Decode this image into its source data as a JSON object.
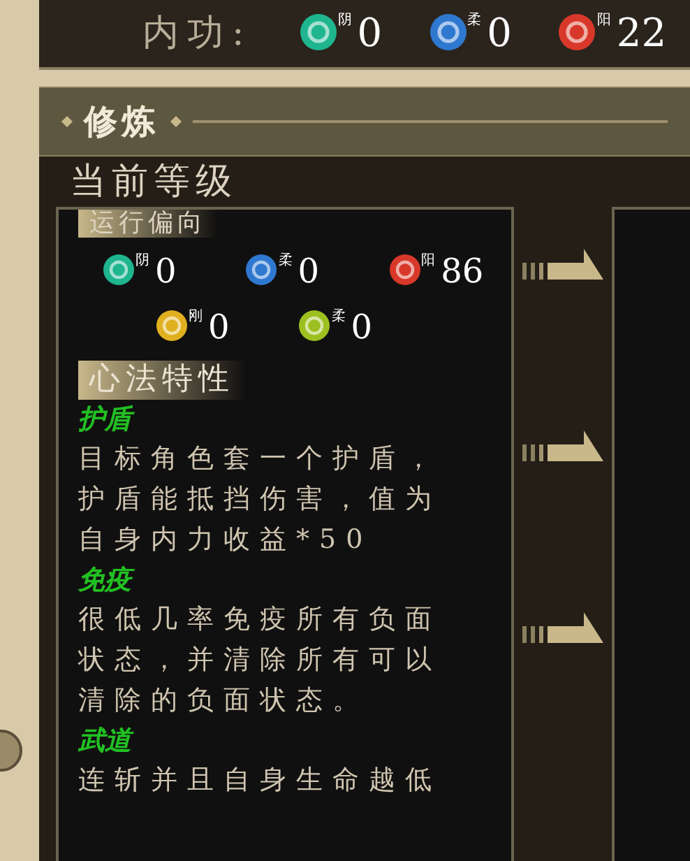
{
  "internal_power": {
    "label": "内功:",
    "orbs": [
      {
        "tag": "阴",
        "value": "0",
        "color": "#1fb58f"
      },
      {
        "tag": "柔",
        "value": "0",
        "color": "#2f78d0"
      },
      {
        "tag": "阳",
        "value": "22",
        "color": "#d8382a"
      }
    ]
  },
  "cultivation": {
    "title": "修炼",
    "level_label": "当前等级",
    "tendency": {
      "title": "运行偏向",
      "rows": [
        [
          {
            "tag": "阴",
            "value": "0",
            "color": "#1fb58f"
          },
          {
            "tag": "柔",
            "value": "0",
            "color": "#2f78d0"
          },
          {
            "tag": "阳",
            "value": "86",
            "color": "#d8382a"
          }
        ],
        [
          {
            "tag": "刚",
            "value": "0",
            "color": "#e0b020"
          },
          {
            "tag": "柔",
            "value": "0",
            "color": "#9cc020"
          }
        ]
      ]
    },
    "traits_title": "心法特性",
    "traits": [
      {
        "name": "护盾",
        "desc": "目标角色套一个护盾，护盾能抵挡伤害，值为自身内力收益*50"
      },
      {
        "name": "免疫",
        "desc": "很低几率免疫所有负面状态，并清除所有可以清除的负面状态。"
      },
      {
        "name": "武道",
        "desc": "连斩并且自身生命越低"
      }
    ]
  }
}
